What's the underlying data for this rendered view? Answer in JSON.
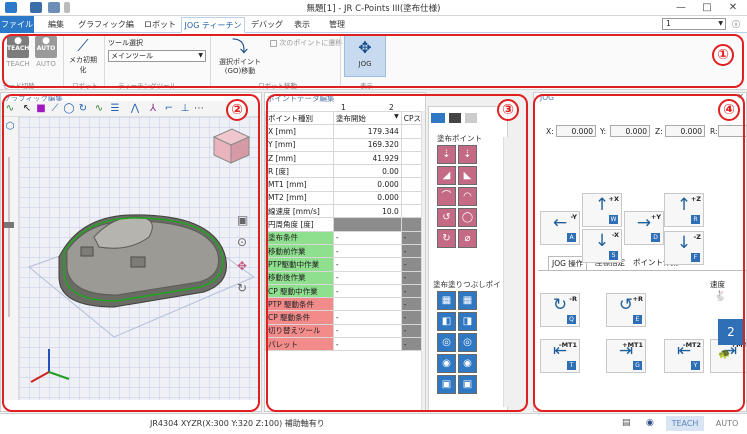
{
  "window": {
    "title": "無題[1] - JR C-Points III(塗布仕様)",
    "minimize": "—",
    "maximize": "□",
    "close": "✕"
  },
  "tabs": [
    {
      "label": "ファイル"
    },
    {
      "label": "編集"
    },
    {
      "label": "グラフィック編集"
    },
    {
      "label": "ロボット"
    },
    {
      "label": "JOG ティーチング"
    },
    {
      "label": "デバッグ"
    },
    {
      "label": "表示"
    },
    {
      "label": "管理"
    }
  ],
  "active_tab_index": 4,
  "profile_select": {
    "value": "1"
  },
  "ribbon": {
    "teach_label": "TEACH",
    "teach_caption": "TEACH",
    "auto_label": "AUTO",
    "auto_caption": "AUTO",
    "mech_init_label": "メカ初期化",
    "tool_select_label": "ツール選択",
    "tool_select_value": "メインツール",
    "move_to_point_label": "選択ポイント(GO)移動",
    "next_point_checkbox_label": "次のポイントに遷移",
    "jog_label": "JOG",
    "group_mode": "モード切替",
    "group_robot": "ロボット",
    "group_teach_tool": "ティーチングツール",
    "group_robot_move": "ロボット移動",
    "group_display": "表示"
  },
  "graphic_panel": {
    "title": "グラフィック編集"
  },
  "point_panel": {
    "title": "ポイントデータ編集",
    "col1": "1",
    "col2": "2",
    "header_label": "ポイント種別",
    "header_value": "塗布開始",
    "header_v2": "CPス",
    "rows": [
      {
        "label": "X [mm]",
        "value": "179.344",
        "v2": "",
        "color": ""
      },
      {
        "label": "Y [mm]",
        "value": "169.320",
        "v2": "",
        "color": ""
      },
      {
        "label": "Z [mm]",
        "value": "41.929",
        "v2": "",
        "color": ""
      },
      {
        "label": "R [度]",
        "value": "0.00",
        "v2": "",
        "color": ""
      },
      {
        "label": "MT1 [mm]",
        "value": "0.000",
        "v2": "",
        "color": ""
      },
      {
        "label": "MT2 [mm]",
        "value": "0.000",
        "v2": "",
        "color": ""
      },
      {
        "label": "線速度 [mm/s]",
        "value": "10.0",
        "v2": "",
        "color": ""
      },
      {
        "label": "円周角度 [度]",
        "value": "",
        "v2": "",
        "color": "gray"
      },
      {
        "label": "塗布条件",
        "value": "-",
        "v2": "-",
        "color": "green"
      },
      {
        "label": "移動前作業",
        "value": "-",
        "v2": "-",
        "color": "green"
      },
      {
        "label": "PTP駆動中作業",
        "value": "-",
        "v2": "-",
        "color": "green"
      },
      {
        "label": "移動後作業",
        "value": "-",
        "v2": "-",
        "color": "green"
      },
      {
        "label": "CP 駆動中作業",
        "value": "-",
        "v2": "-",
        "color": "green"
      },
      {
        "label": "PTP 駆動条件",
        "value": "",
        "v2": "-",
        "color": "red"
      },
      {
        "label": "CP 駆動条件",
        "value": "-",
        "v2": "-",
        "color": "red"
      },
      {
        "label": "切り替えツール",
        "value": "-",
        "v2": "-",
        "color": "red"
      },
      {
        "label": "パレット",
        "value": "-",
        "v2": "-",
        "color": "red"
      }
    ]
  },
  "palette": {
    "section1_title": "塗布ポイント",
    "section2_title": "塗布塗りつぶしポイ"
  },
  "jog_panel": {
    "title": "JOG",
    "x_label": "X:",
    "x_value": "0.000",
    "y_label": "Y:",
    "y_value": "0.000",
    "z_label": "Z:",
    "z_value": "0.000",
    "r_label": "R:",
    "tabs": [
      "JOG 操作",
      "座標指定",
      "ポイント作業"
    ],
    "speed_label": "速度",
    "buttons": [
      {
        "arrow": "↑",
        "axis": "+X",
        "key": "W"
      },
      {
        "arrow": "←",
        "axis": "-Y",
        "key": "A"
      },
      {
        "arrow": "→",
        "axis": "+Y",
        "key": "D"
      },
      {
        "arrow": "↓",
        "axis": "-X",
        "key": "S"
      },
      {
        "arrow": "↑",
        "axis": "+Z",
        "key": "R"
      },
      {
        "arrow": "↓",
        "axis": "-Z",
        "key": "F"
      },
      {
        "arrow": "↻",
        "axis": "-R",
        "key": "Q"
      },
      {
        "arrow": "↺",
        "axis": "+R",
        "key": "E"
      },
      {
        "arrow": "⇤",
        "axis": "-MT1",
        "key": "T"
      },
      {
        "arrow": "⇥",
        "axis": "+MT1",
        "key": "G"
      },
      {
        "arrow": "⇤",
        "axis": "-MT2",
        "key": "Y"
      },
      {
        "arrow": "⇥",
        "axis": "+MT",
        "key": ""
      }
    ],
    "speed_levels": [
      "3",
      "2",
      "1"
    ]
  },
  "statusbar": {
    "text": "JR4304 XYZR(X:300 Y:320 Z:100) 補助軸有り",
    "teach": "TEACH",
    "auto": "AUTO"
  },
  "annotations": [
    "①",
    "②",
    "③",
    "④"
  ],
  "colors": {
    "accent": "#2b79c8",
    "annotation": "#e02020",
    "palette_pink": "#c46a84",
    "palette_blue": "#2f78c4"
  }
}
